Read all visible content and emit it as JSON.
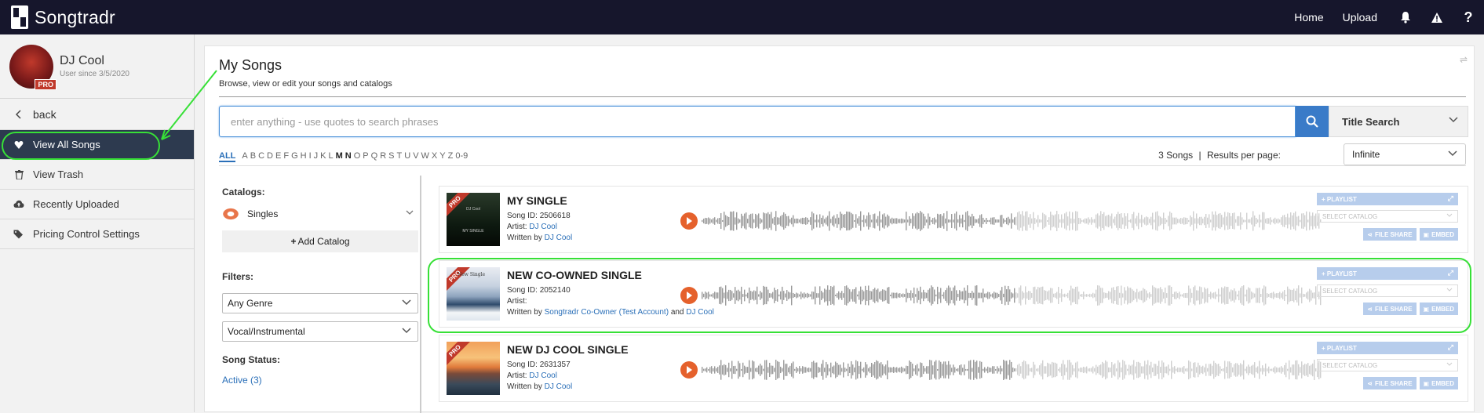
{
  "app": {
    "name": "Songtradr"
  },
  "nav": {
    "home": "Home",
    "upload": "Upload"
  },
  "profile": {
    "name": "DJ Cool",
    "since": "User since 3/5/2020",
    "badge": "PRO"
  },
  "sidebar": {
    "back": "back",
    "items": [
      {
        "label": "View All Songs",
        "icon": "heart-icon",
        "active": true
      },
      {
        "label": "View Trash",
        "icon": "trash-icon"
      },
      {
        "label": "Recently Uploaded",
        "icon": "cloud-upload-icon"
      },
      {
        "label": "Pricing Control Settings",
        "icon": "tags-icon"
      }
    ]
  },
  "page": {
    "title": "My Songs",
    "subtitle": "Browse, view or edit your songs and catalogs"
  },
  "search": {
    "placeholder": "enter anything - use quotes to search phrases",
    "type": "Title Search"
  },
  "alphabet": {
    "all": "ALL",
    "letters": [
      "A",
      "B",
      "C",
      "D",
      "E",
      "F",
      "G",
      "H",
      "I",
      "J",
      "K",
      "L",
      "M",
      "N",
      "O",
      "P",
      "Q",
      "R",
      "S",
      "T",
      "U",
      "V",
      "W",
      "X",
      "Y",
      "Z",
      "0-9"
    ],
    "bold": [
      "M",
      "N"
    ]
  },
  "results": {
    "count_text": "3 Songs",
    "separator": "|",
    "per_page_label": "Results per page:",
    "per_page_value": "Infinite"
  },
  "filters": {
    "catalogs_label": "Catalogs:",
    "catalog_value": "Singles",
    "add_catalog": "Add Catalog",
    "filters_label": "Filters:",
    "genre": "Any Genre",
    "vocal": "Vocal/Instrumental",
    "status_label": "Song Status:",
    "active": "Active (3)"
  },
  "songs": [
    {
      "title": "MY SINGLE",
      "id_label": "Song ID:",
      "id": "2506618",
      "artist_label": "Artist:",
      "artist": "DJ Cool",
      "written_label": "Written by",
      "writers": [
        "DJ Cool"
      ],
      "pro": "PRO"
    },
    {
      "title": "NEW CO-OWNED SINGLE",
      "id_label": "Song ID:",
      "id": "2052140",
      "artist_label": "Artist:",
      "artist": "",
      "written_label": "Written by",
      "writers": [
        "Songtradr Co-Owner (Test Account)",
        "DJ Cool"
      ],
      "writers_join": "and",
      "pro": "PRO"
    },
    {
      "title": "NEW DJ COOL SINGLE",
      "id_label": "Song ID:",
      "id": "2631357",
      "artist_label": "Artist:",
      "artist": "DJ Cool",
      "written_label": "Written by",
      "writers": [
        "DJ Cool"
      ],
      "pro": "PRO"
    }
  ],
  "song_actions": {
    "playlist": "PLAYLIST",
    "select_catalog": "SELECT CATALOG",
    "file_share": "FILE SHARE",
    "embed": "EMBED"
  },
  "colors": {
    "topbar": "#16162c",
    "active_nav": "#2d3a4f",
    "accent": "#3a7bc8",
    "play": "#e5612c",
    "highlight": "#37e037"
  }
}
